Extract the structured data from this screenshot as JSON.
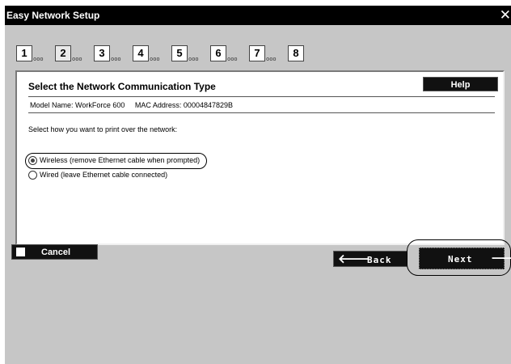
{
  "window": {
    "title": "Easy Network Setup",
    "close_glyph": "✕"
  },
  "steps": [
    {
      "label": "1",
      "dots": "ooo"
    },
    {
      "label": "2",
      "dots": "ooo"
    },
    {
      "label": "3",
      "dots": "ooo"
    },
    {
      "label": "4",
      "dots": "ooo"
    },
    {
      "label": "5",
      "dots": "ooo"
    },
    {
      "label": "6",
      "dots": "ooo"
    },
    {
      "label": "7",
      "dots": "ooo"
    },
    {
      "label": "8",
      "dots": ""
    }
  ],
  "current_step": 2,
  "panel": {
    "title": "Select the Network Communication Type",
    "help_label": "Help",
    "model_name": "Model Name: WorkForce 600",
    "mac_address": "MAC Address: 00004847829B",
    "instruction": "Select how you want to print over the network:",
    "options": [
      {
        "label": "Wireless (remove Ethernet cable when prompted)",
        "selected": true
      },
      {
        "label": "Wired (leave Ethernet cable connected)",
        "selected": false
      }
    ]
  },
  "buttons": {
    "cancel": "Cancel",
    "back": "Back",
    "back_arrow": "🡐",
    "next": "Next",
    "next_arrow": "🡒"
  },
  "icons": {
    "close": "close-icon",
    "back": "arrow-left-icon",
    "next": "arrow-right-icon",
    "cancel": "square-icon"
  },
  "colors": {
    "titlebar": "#000000",
    "window_bg": "#c6c6c6",
    "button_bg": "#111111",
    "panel_bg": "#ffffff"
  }
}
